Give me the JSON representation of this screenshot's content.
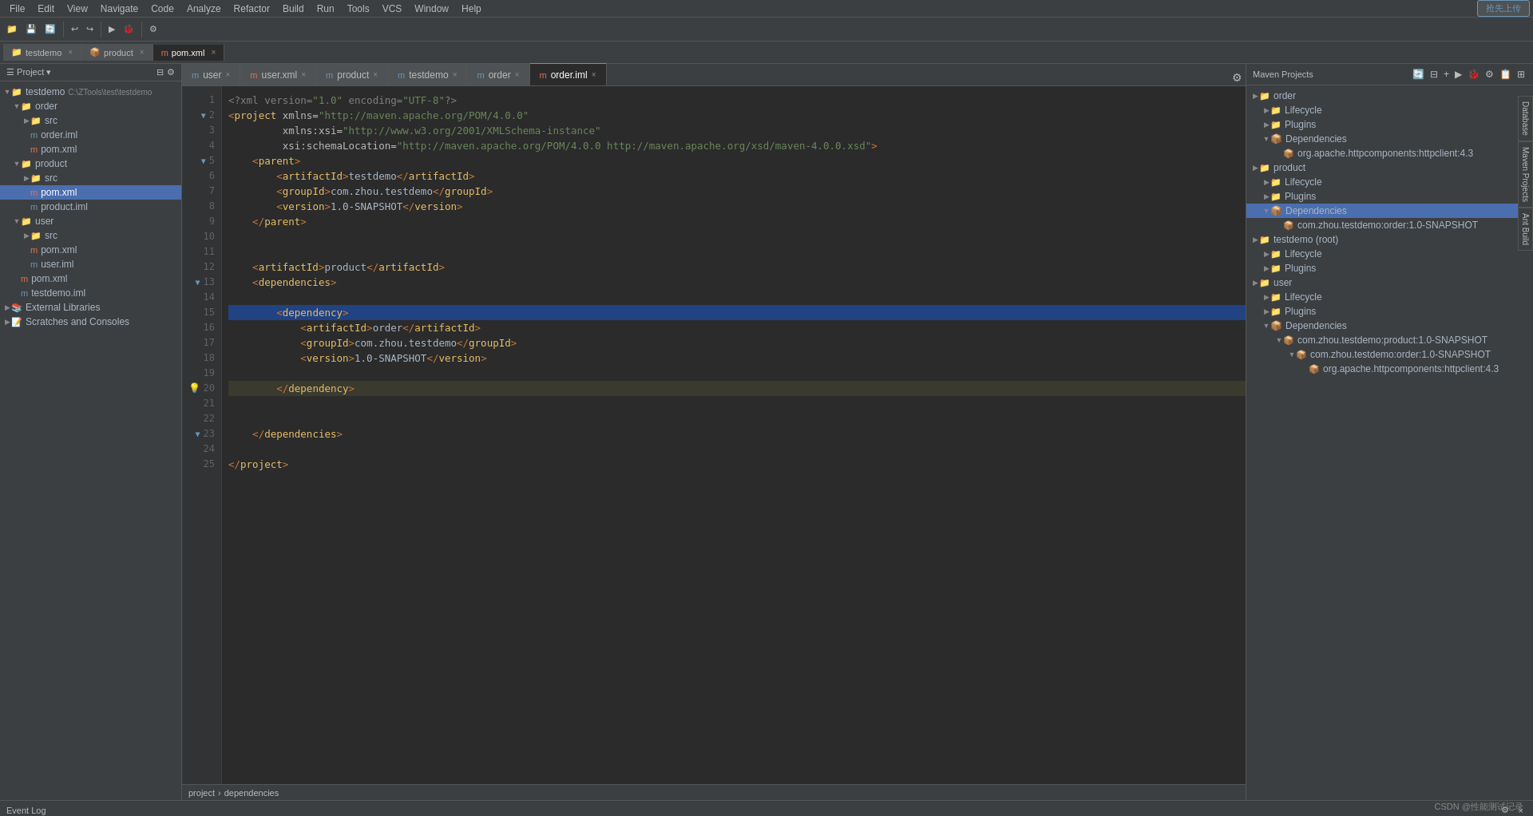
{
  "menubar": {
    "items": [
      "File",
      "Edit",
      "View",
      "Navigate",
      "Code",
      "Analyze",
      "Refactor",
      "Build",
      "Run",
      "Tools",
      "VCS",
      "Window",
      "Help"
    ]
  },
  "project_tabs": [
    {
      "label": "testdemo",
      "active": false
    },
    {
      "label": "product",
      "active": false
    },
    {
      "label": "pom.xml",
      "active": true
    }
  ],
  "editor_tabs": [
    {
      "label": "user",
      "icon": "m",
      "active": false,
      "modified": false
    },
    {
      "label": "user.xml",
      "icon": "m",
      "active": false,
      "modified": false
    },
    {
      "label": "product",
      "icon": "m",
      "active": false,
      "modified": false
    },
    {
      "label": "testdemo",
      "icon": "m",
      "active": false,
      "modified": false
    },
    {
      "label": "order",
      "icon": "m",
      "active": false,
      "modified": false
    },
    {
      "label": "order.iml",
      "icon": "m",
      "active": true,
      "modified": false
    }
  ],
  "project_tree": {
    "title": "Project",
    "root": "testdemo",
    "root_path": "C:\\ZTools\\test\\testdemo",
    "items": [
      {
        "id": "order",
        "label": "order",
        "type": "folder",
        "indent": 1,
        "expanded": true
      },
      {
        "id": "order-src",
        "label": "src",
        "type": "folder",
        "indent": 2,
        "expanded": false
      },
      {
        "id": "order-iml",
        "label": "order.iml",
        "type": "iml",
        "indent": 2
      },
      {
        "id": "order-pom",
        "label": "pom.xml",
        "type": "xml",
        "indent": 2
      },
      {
        "id": "product",
        "label": "product",
        "type": "folder",
        "indent": 1,
        "expanded": true
      },
      {
        "id": "product-src",
        "label": "src",
        "type": "folder",
        "indent": 2,
        "expanded": false
      },
      {
        "id": "product-pom",
        "label": "pom.xml",
        "type": "xml",
        "indent": 2,
        "selected": true
      },
      {
        "id": "product-iml",
        "label": "product.iml",
        "type": "iml",
        "indent": 2
      },
      {
        "id": "user",
        "label": "user",
        "type": "folder",
        "indent": 1,
        "expanded": true
      },
      {
        "id": "user-src",
        "label": "src",
        "type": "folder",
        "indent": 2,
        "expanded": false
      },
      {
        "id": "user-pom",
        "label": "pom.xml",
        "type": "xml",
        "indent": 2
      },
      {
        "id": "user-iml",
        "label": "user.iml",
        "type": "iml",
        "indent": 2
      },
      {
        "id": "root-pom",
        "label": "pom.xml",
        "type": "xml",
        "indent": 1
      },
      {
        "id": "testdemo-iml",
        "label": "testdemo.iml",
        "type": "iml",
        "indent": 1
      },
      {
        "id": "ext-lib",
        "label": "External Libraries",
        "type": "folder",
        "indent": 0,
        "expanded": false
      },
      {
        "id": "scratches",
        "label": "Scratches and Consoles",
        "type": "folder",
        "indent": 0,
        "expanded": false
      }
    ]
  },
  "code_lines": [
    {
      "num": 1,
      "content": "<?xml version=\"1.0\" encoding=\"UTF-8\"?>",
      "type": "decl"
    },
    {
      "num": 2,
      "content": "<project xmlns=\"http://maven.apache.org/POM/4.0.0\"",
      "type": "tag",
      "marker": "fold"
    },
    {
      "num": 3,
      "content": "         xmlns:xsi=\"http://www.w3.org/2001/XMLSchema-instance\"",
      "type": "attr"
    },
    {
      "num": 4,
      "content": "         xsi:schemaLocation=\"http://maven.apache.org/POM/4.0.0 http://maven.apache.org/xsd/maven-4.0.0.xsd\">",
      "type": "attr"
    },
    {
      "num": 5,
      "content": "    <parent>",
      "type": "tag",
      "marker": "fold"
    },
    {
      "num": 6,
      "content": "        <artifactId>testdemo</artifactId>",
      "type": "tag"
    },
    {
      "num": 7,
      "content": "        <groupId>com.zhou.testdemo</groupId>",
      "type": "tag"
    },
    {
      "num": 8,
      "content": "        <version>1.0-SNAPSHOT</version>",
      "type": "tag"
    },
    {
      "num": 9,
      "content": "    </parent>",
      "type": "tag"
    },
    {
      "num": 10,
      "content": "",
      "type": "empty"
    },
    {
      "num": 11,
      "content": "",
      "type": "empty"
    },
    {
      "num": 12,
      "content": "    <artifactId>product</artifactId>",
      "type": "tag"
    },
    {
      "num": 13,
      "content": "    <dependencies>",
      "type": "tag",
      "marker": "fold"
    },
    {
      "num": 14,
      "content": "",
      "type": "empty"
    },
    {
      "num": 15,
      "content": "        <dependency>",
      "type": "tag",
      "selected": true
    },
    {
      "num": 16,
      "content": "            <artifactId>order</artifactId>",
      "type": "tag"
    },
    {
      "num": 17,
      "content": "            <groupId>com.zhou.testdemo</groupId>",
      "type": "tag"
    },
    {
      "num": 18,
      "content": "            <version>1.0-SNAPSHOT</version>",
      "type": "tag"
    },
    {
      "num": 19,
      "content": "",
      "type": "empty"
    },
    {
      "num": 20,
      "content": "        </dependency>",
      "type": "tag",
      "highlighted": true,
      "bulb": true
    },
    {
      "num": 21,
      "content": "",
      "type": "empty"
    },
    {
      "num": 22,
      "content": "",
      "type": "empty"
    },
    {
      "num": 23,
      "content": "    </dependencies>",
      "type": "tag",
      "marker": "fold"
    },
    {
      "num": 24,
      "content": "",
      "type": "empty"
    },
    {
      "num": 25,
      "content": "</project>",
      "type": "tag"
    }
  ],
  "status_bar": {
    "breadcrumb": [
      "project",
      ">",
      "dependencies"
    ]
  },
  "maven_panel": {
    "title": "Maven Projects",
    "tree": [
      {
        "id": "order",
        "label": "order",
        "type": "root",
        "indent": 0,
        "expanded": true
      },
      {
        "id": "order-lifecycle",
        "label": "Lifecycle",
        "type": "folder",
        "indent": 1,
        "expanded": false
      },
      {
        "id": "order-plugins",
        "label": "Plugins",
        "type": "folder",
        "indent": 1,
        "expanded": false
      },
      {
        "id": "order-deps",
        "label": "Dependencies",
        "type": "deps",
        "indent": 1,
        "expanded": true
      },
      {
        "id": "order-httpclient",
        "label": "org.apache.httpcomponents:httpclient:4.3",
        "type": "dep",
        "indent": 2
      },
      {
        "id": "product",
        "label": "product",
        "type": "root",
        "indent": 0,
        "expanded": true
      },
      {
        "id": "product-lifecycle",
        "label": "Lifecycle",
        "type": "folder",
        "indent": 1,
        "expanded": false
      },
      {
        "id": "product-plugins",
        "label": "Plugins",
        "type": "folder",
        "indent": 1,
        "expanded": false
      },
      {
        "id": "product-deps",
        "label": "Dependencies",
        "type": "deps",
        "indent": 1,
        "expanded": true,
        "selected": true
      },
      {
        "id": "product-dep-order",
        "label": "com.zhou.testdemo:order:1.0-SNAPSHOT",
        "type": "dep",
        "indent": 2
      },
      {
        "id": "testdemo-root",
        "label": "testdemo (root)",
        "type": "root",
        "indent": 0,
        "expanded": true
      },
      {
        "id": "testdemo-lifecycle",
        "label": "Lifecycle",
        "type": "folder",
        "indent": 1,
        "expanded": false
      },
      {
        "id": "testdemo-plugins",
        "label": "Plugins",
        "type": "folder",
        "indent": 1,
        "expanded": false
      },
      {
        "id": "user-root",
        "label": "user",
        "type": "root",
        "indent": 0,
        "expanded": true
      },
      {
        "id": "user-lifecycle",
        "label": "Lifecycle",
        "type": "folder",
        "indent": 1,
        "expanded": false
      },
      {
        "id": "user-plugins",
        "label": "Plugins",
        "type": "folder",
        "indent": 1,
        "expanded": false
      },
      {
        "id": "user-deps",
        "label": "Dependencies",
        "type": "deps",
        "indent": 1,
        "expanded": true
      },
      {
        "id": "user-dep-product",
        "label": "com.zhou.testdemo:product:1.0-SNAPSHOT",
        "type": "dep",
        "indent": 2
      },
      {
        "id": "user-dep-order",
        "label": "com.zhou.testdemo:order:1.0-SNAPSHOT",
        "type": "dep",
        "indent": 3
      },
      {
        "id": "user-dep-httpclient",
        "label": "org.apache.httpcomponents:httpclient:4.3",
        "type": "dep",
        "indent": 4
      }
    ]
  },
  "event_log": {
    "title": "Event Log"
  },
  "bottom_right": "CSDN @性能测试记录",
  "top_right_btn": "抢先上传",
  "right_side_tabs": [
    "Database",
    "Maven Projects",
    "Ant Build"
  ]
}
